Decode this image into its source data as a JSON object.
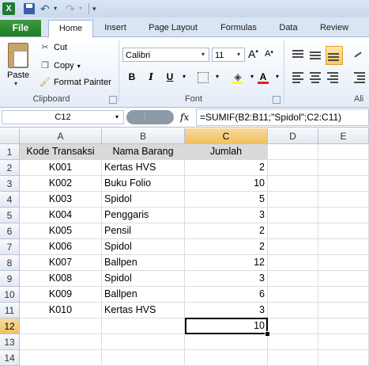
{
  "qat": {
    "app_icon": "X"
  },
  "tabs": [
    "File",
    "Home",
    "Insert",
    "Page Layout",
    "Formulas",
    "Data",
    "Review"
  ],
  "clipboard": {
    "paste": "Paste",
    "cut": "Cut",
    "copy": "Copy",
    "format_painter": "Format Painter",
    "label": "Clipboard"
  },
  "font": {
    "name": "Calibri",
    "size": "11",
    "label": "Font",
    "grow": "A",
    "shrink": "A",
    "bold": "B",
    "italic": "I",
    "underline": "U",
    "font_color": "A"
  },
  "alignment": {
    "label_partial": "Ali"
  },
  "formula_bar": {
    "name_box": "C12",
    "fx": "fx",
    "formula": "=SUMIF(B2:B11;\"Spidol\";C2:C11)"
  },
  "columns": [
    "A",
    "B",
    "C",
    "D",
    "E"
  ],
  "rows": [
    "1",
    "2",
    "3",
    "4",
    "5",
    "6",
    "7",
    "8",
    "9",
    "10",
    "11",
    "12",
    "13",
    "14"
  ],
  "headers": [
    "Kode Transaksi",
    "Nama Barang",
    "Jumlah"
  ],
  "data": [
    [
      "K001",
      "Kertas HVS",
      "2"
    ],
    [
      "K002",
      "Buku Folio",
      "10"
    ],
    [
      "K003",
      "Spidol",
      "5"
    ],
    [
      "K004",
      "Penggaris",
      "3"
    ],
    [
      "K005",
      "Pensil",
      "2"
    ],
    [
      "K006",
      "Spidol",
      "2"
    ],
    [
      "K007",
      "Ballpen",
      "12"
    ],
    [
      "K008",
      "Spidol",
      "3"
    ],
    [
      "K009",
      "Ballpen",
      "6"
    ],
    [
      "K010",
      "Kertas HVS",
      "3"
    ]
  ],
  "result": "10",
  "colors": {
    "file_tab": "#2a8a2e",
    "selected_header": "#f1c15f",
    "accent": "#3a5fa8"
  }
}
